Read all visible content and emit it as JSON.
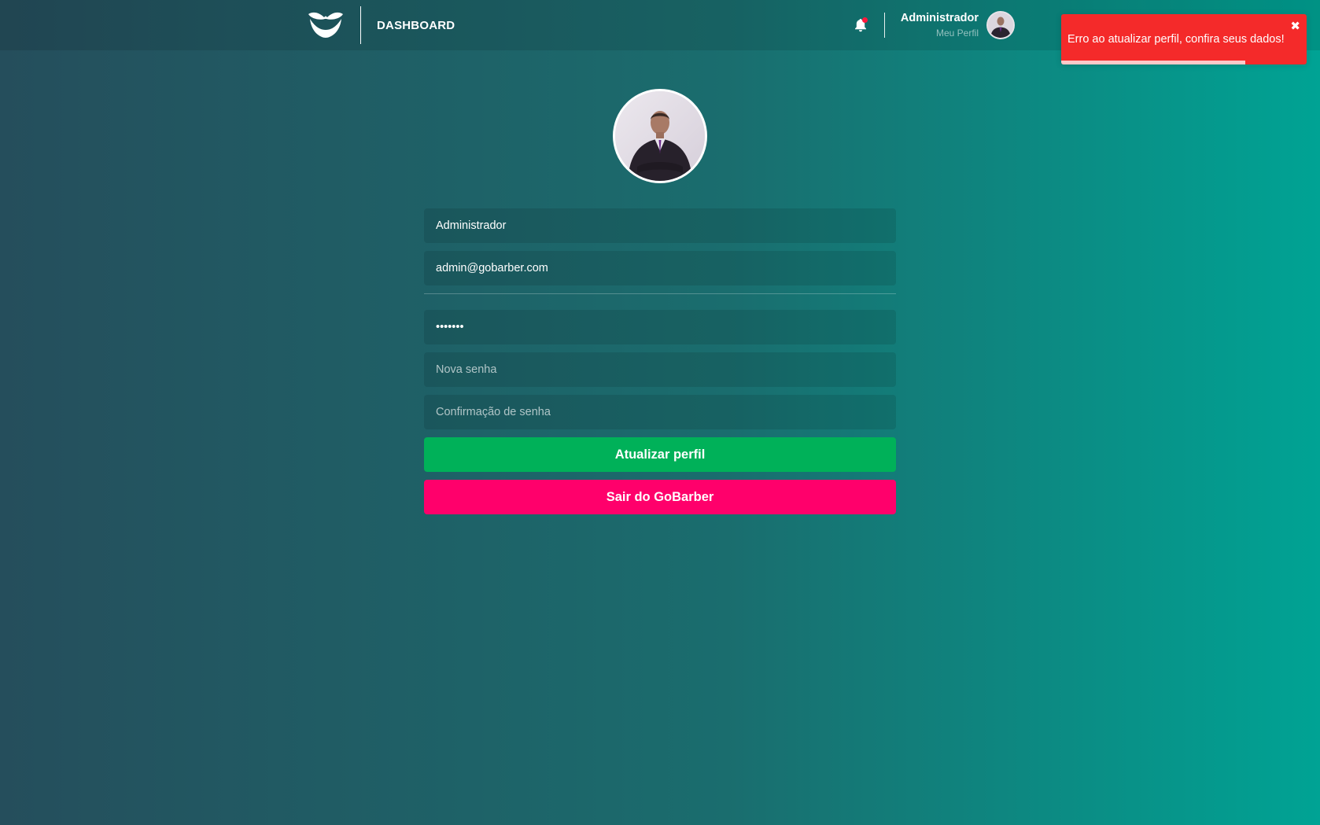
{
  "header": {
    "nav_link": "DASHBOARD",
    "profile": {
      "name": "Administrador",
      "link": "Meu Perfil"
    },
    "has_notifications": true
  },
  "form": {
    "name_value": "Administrador",
    "email_value": "admin@gobarber.com",
    "old_password_value": "•••••••",
    "new_password_placeholder": "Nova senha",
    "confirm_password_placeholder": "Confirmação de senha",
    "submit_label": "Atualizar perfil",
    "logout_label": "Sair do GoBarber"
  },
  "toast": {
    "type": "error",
    "message": "Erro ao atualizar perfil, confira seus dados!",
    "close_icon": "✖",
    "progress_fraction": 0.75
  },
  "icons": {
    "logo": "mustache-icon",
    "notifications": "bell-icon"
  },
  "colors": {
    "accent_update": "#00b159",
    "accent_logout": "#ff006b",
    "toast_error": "#f42a2a",
    "notification_dot": "#ff1a3d"
  }
}
